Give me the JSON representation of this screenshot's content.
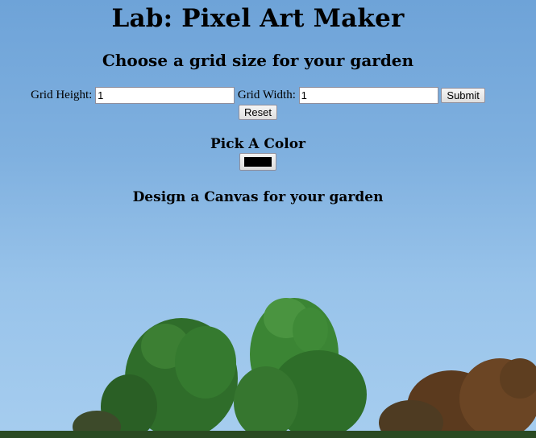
{
  "page": {
    "title": "Lab: Pixel Art Maker"
  },
  "grid_form": {
    "heading": "Choose a grid size for your garden",
    "height_label": "Grid Height:",
    "height_value": "1",
    "width_label": "Grid Width:",
    "width_value": "1",
    "submit_label": "Submit",
    "reset_label": "Reset"
  },
  "color_picker": {
    "heading": "Pick A Color",
    "value": "#000000"
  },
  "canvas": {
    "heading": "Design a Canvas for your garden"
  },
  "colors": {
    "sky_top": "#6ea3d8",
    "sky_bottom": "#a6cdef",
    "foliage": "#2f6d2a",
    "autumn_foliage": "#5b3a1e"
  }
}
